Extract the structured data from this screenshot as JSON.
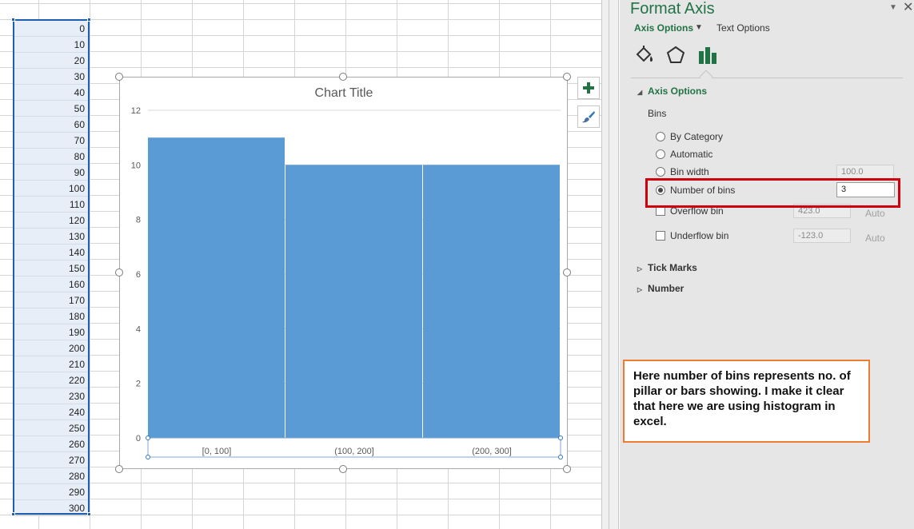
{
  "sheet": {
    "column_values": [
      "0",
      "10",
      "20",
      "30",
      "40",
      "50",
      "60",
      "70",
      "80",
      "90",
      "100",
      "110",
      "120",
      "130",
      "140",
      "150",
      "160",
      "170",
      "180",
      "190",
      "200",
      "210",
      "220",
      "230",
      "240",
      "250",
      "260",
      "270",
      "280",
      "290",
      "300"
    ]
  },
  "chart_data": {
    "type": "bar",
    "title": "Chart Title",
    "categories": [
      "[0, 100]",
      "(100, 200]",
      "(200, 300]"
    ],
    "values": [
      11,
      10,
      10
    ],
    "yticks": [
      0,
      2,
      4,
      6,
      8,
      10,
      12
    ],
    "ylim": [
      0,
      12
    ],
    "color": "#5b9bd5",
    "grid": true
  },
  "chart_buttons": {
    "elements_icon": "plus-icon",
    "styles_icon": "brush-icon"
  },
  "pane": {
    "title": "Format Axis",
    "tabs": {
      "axis_options": "Axis Options",
      "text_options": "Text Options"
    },
    "icons": [
      "fill-line-icon",
      "effects-pentagon-icon",
      "axis-options-bar-icon"
    ],
    "section_axis_options": "Axis Options",
    "bins_label": "Bins",
    "options": {
      "by_category": "By Category",
      "automatic": "Automatic",
      "bin_width": "Bin width",
      "bin_width_value": "100.0",
      "number_of_bins": "Number of bins",
      "number_of_bins_value": "3",
      "overflow_bin": "Overflow bin",
      "overflow_value": "423.0",
      "overflow_auto": "Auto",
      "underflow_bin": "Underflow bin",
      "underflow_value": "-123.0",
      "underflow_auto": "Auto"
    },
    "section_tick_marks": "Tick Marks",
    "section_number": "Number",
    "accent_color": "#217346"
  },
  "note": {
    "text": "Here number of bins represents no. of  pillar or bars showing. I make it clear that here we are using histogram in excel.",
    "border_color": "#ed7d31"
  },
  "highlight_color": "#d0000d"
}
